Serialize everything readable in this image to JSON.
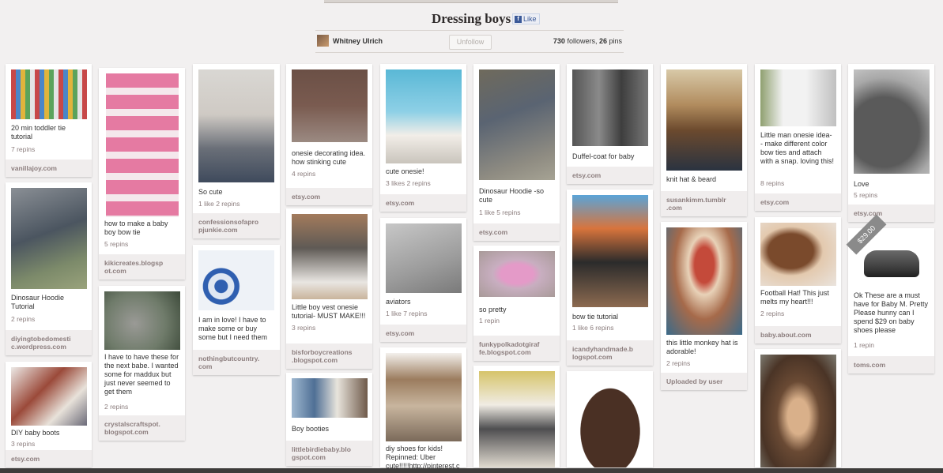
{
  "board": {
    "title": "Dressing boys",
    "like_label": "Like",
    "owner": "Whitney Ulrich",
    "unfollow_label": "Unfollow",
    "followers": "730",
    "followers_label": " followers, ",
    "pins": "26",
    "pins_label": " pins"
  },
  "pins": {
    "p1": {
      "desc": "20 min toddler tie tutorial",
      "stat": "7 repins",
      "src": "vanillajoy.com"
    },
    "p2": {
      "desc": "Dinosaur Hoodie Tutorial",
      "stat": "2 repins",
      "src": "diyingtobedomesti c.wordpress.com"
    },
    "p3": {
      "desc": "DIY baby boots",
      "stat": "3 repins",
      "src": "etsy.com"
    },
    "p4": {
      "desc": "how to make a baby boy bow tie",
      "stat": "5 repins",
      "src": "kikicreates.blogsp ot.com"
    },
    "p5": {
      "desc": "I have to have these for the next babe. I wanted some for maddux but just never seemed to get them",
      "stat": "2 repins",
      "src": "crystalscraftspot. blogspot.com"
    },
    "p6": {
      "desc": "So cute",
      "stat": "1 like  2 repins",
      "src": "confessionsofapro pjunkie.com"
    },
    "p7": {
      "desc": "I am in love! I have to make some or buy some but I need them",
      "stat": "",
      "src": "nothingbutcountry. com"
    },
    "p8": {
      "desc": "onesie decorating idea. how stinking cute",
      "stat": "4 repins",
      "src": "etsy.com"
    },
    "p9": {
      "desc": "Little boy vest onesie tutorial- MUST MAKE!!!",
      "stat": "3 repins",
      "src": "bisforboycreations .blogspot.com"
    },
    "p10": {
      "desc": "Boy booties",
      "stat": "",
      "src": "littlebirdiebaby.blo gspot.com"
    },
    "p11": {
      "desc": "cute onesie!",
      "stat": "3 likes  2 repins",
      "src": "etsy.com"
    },
    "p12": {
      "desc": "aviators",
      "stat": "1 like  7 repins",
      "src": "etsy.com"
    },
    "p13": {
      "desc": "diy shoes for kids! Repinned: Uber cute!!!!!http://pinterest.c",
      "stat": "",
      "src": ""
    },
    "p14": {
      "desc": "Dinosaur Hoodie -so cute",
      "stat": "1 like  5 repins",
      "src": "etsy.com"
    },
    "p15": {
      "desc": "so pretty",
      "stat": "1 repin",
      "src": "funkypolkadotgiraf fe.blogspot.com"
    },
    "p16": {
      "desc": "Duffel-coat for baby",
      "stat": "",
      "src": "etsy.com"
    },
    "p17": {
      "desc": "bow tie tutorial",
      "stat": "1 like  6 repins",
      "src": "icandyhandmade.b logspot.com"
    },
    "p18": {
      "desc": "knit hat & beard",
      "stat": "",
      "src": "susankimm.tumblr .com"
    },
    "p19": {
      "desc": "this little monkey hat is adorable!",
      "stat": "2 repins",
      "src": "Uploaded by user"
    },
    "p20": {
      "desc": "Little man onesie idea- - make different color bow ties and attach with a snap. loving this!",
      "stat": "8 repins",
      "src": "etsy.com"
    },
    "p21": {
      "desc": "Football Hat! This just melts my heart!!!",
      "stat": "2 repins",
      "src": "baby.about.com"
    },
    "p22": {
      "desc": "Love",
      "stat": "5 repins",
      "src": "etsy.com"
    },
    "p23": {
      "desc": "Ok These are a must have for Baby M. Pretty Please hunny can I spend $29 on baby shoes please",
      "stat": "1 repin",
      "src": "toms.com"
    },
    "price_tag": "$29.00"
  },
  "colors": {
    "background": "#f2f0f0",
    "facebook": "#3b5998",
    "source_bar": "#f0eded"
  }
}
